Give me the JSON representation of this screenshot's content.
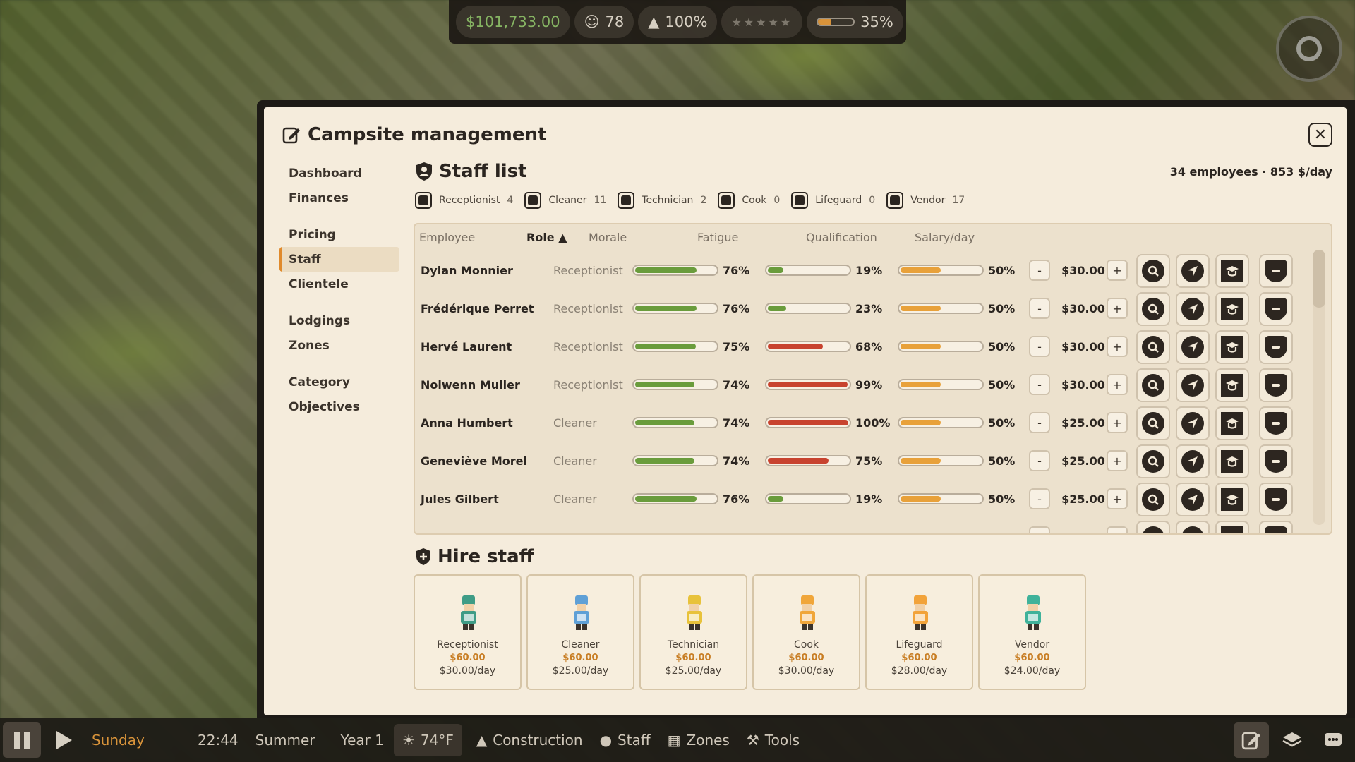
{
  "hud": {
    "money": "$101,733.00",
    "guests": "78",
    "ratio": "100%",
    "rating_stars": "★★★★★",
    "progress_text": "35%",
    "progress_value": 0.35
  },
  "panel": {
    "title": "Campsite management",
    "close_glyph": "✕"
  },
  "sidebar": {
    "items": [
      {
        "label": "Dashboard"
      },
      {
        "label": "Finances"
      },
      {
        "label": "Pricing"
      },
      {
        "label": "Staff"
      },
      {
        "label": "Clientele"
      },
      {
        "label": "Lodgings"
      },
      {
        "label": "Zones"
      },
      {
        "label": "Category"
      },
      {
        "label": "Objectives"
      }
    ],
    "active": "Staff"
  },
  "staff": {
    "title": "Staff list",
    "summary": "34 employees · 853 $/day",
    "filters": [
      {
        "label": "Receptionist",
        "count": "4"
      },
      {
        "label": "Cleaner",
        "count": "11"
      },
      {
        "label": "Technician",
        "count": "2"
      },
      {
        "label": "Cook",
        "count": "0"
      },
      {
        "label": "Lifeguard",
        "count": "0"
      },
      {
        "label": "Vendor",
        "count": "17"
      }
    ],
    "columns": {
      "employee": "Employee",
      "role": "Role ▲",
      "morale": "Morale",
      "fatigue": "Fatigue",
      "qualification": "Qualification",
      "salary": "Salary/day"
    },
    "minus": "-",
    "plus": "+",
    "rows": [
      {
        "name": "Dylan Monnier",
        "role": "Receptionist",
        "morale": "76%",
        "fatigue": "19%",
        "qualification": "50%",
        "salary": "$30.00"
      },
      {
        "name": "Frédérique Perret",
        "role": "Receptionist",
        "morale": "76%",
        "fatigue": "23%",
        "qualification": "50%",
        "salary": "$30.00"
      },
      {
        "name": "Hervé Laurent",
        "role": "Receptionist",
        "morale": "75%",
        "fatigue": "68%",
        "qualification": "50%",
        "salary": "$30.00"
      },
      {
        "name": "Nolwenn Muller",
        "role": "Receptionist",
        "morale": "74%",
        "fatigue": "99%",
        "qualification": "50%",
        "salary": "$30.00"
      },
      {
        "name": "Anna Humbert",
        "role": "Cleaner",
        "morale": "74%",
        "fatigue": "100%",
        "qualification": "50%",
        "salary": "$25.00"
      },
      {
        "name": "Geneviève Morel",
        "role": "Cleaner",
        "morale": "74%",
        "fatigue": "75%",
        "qualification": "50%",
        "salary": "$25.00"
      },
      {
        "name": "Jules Gilbert",
        "role": "Cleaner",
        "morale": "76%",
        "fatigue": "19%",
        "qualification": "50%",
        "salary": "$25.00"
      }
    ]
  },
  "hire": {
    "title": "Hire staff",
    "cards": [
      {
        "role": "Receptionist",
        "price": "$60.00",
        "wage": "$30.00/day",
        "color": "#3f9c86"
      },
      {
        "role": "Cleaner",
        "price": "$60.00",
        "wage": "$25.00/day",
        "color": "#5fa0d6"
      },
      {
        "role": "Technician",
        "price": "$60.00",
        "wage": "$25.00/day",
        "color": "#e8c23a"
      },
      {
        "role": "Cook",
        "price": "$60.00",
        "wage": "$30.00/day",
        "color": "#f0a63a"
      },
      {
        "role": "Lifeguard",
        "price": "$60.00",
        "wage": "$28.00/day",
        "color": "#f2a33a"
      },
      {
        "role": "Vendor",
        "price": "$60.00",
        "wage": "$24.00/day",
        "color": "#3fb29a"
      }
    ]
  },
  "bottom": {
    "day": "Sunday",
    "time": "22:44",
    "season": "Summer",
    "year": "Year 1",
    "temp": "74°F",
    "construction": "Construction",
    "staff": "Staff",
    "zones": "Zones",
    "tools": "Tools"
  },
  "colors": {
    "morale": "#6a9c3c",
    "fatigue_low": "#6a9c3c",
    "fatigue_high": "#c8432f",
    "qualification": "#e8a13a",
    "accent": "#e08a2c"
  },
  "icons": [
    "money-icon",
    "guests-icon",
    "warning-icon",
    "star-icon",
    "edit-icon",
    "close-icon",
    "shield-icon",
    "search-icon",
    "navigate-icon",
    "graduate-icon",
    "fire-icon",
    "plus-shield-icon",
    "pause-icon",
    "play-icon",
    "sun-icon",
    "construction-icon",
    "staff-icon",
    "zones-icon",
    "tools-icon",
    "management-icon",
    "layers-icon",
    "chat-icon"
  ]
}
